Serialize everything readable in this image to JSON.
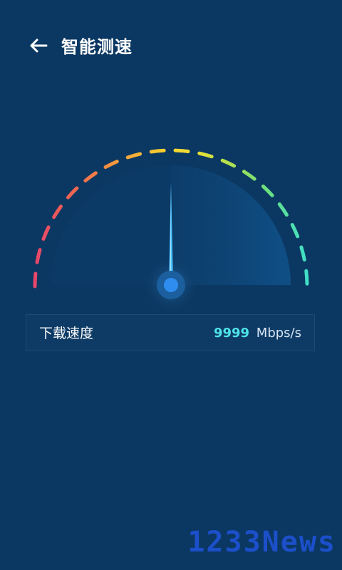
{
  "header": {
    "title": "智能测速",
    "back_icon": "arrow-left-icon"
  },
  "gauge": {
    "needle_level": 0.5,
    "colors": [
      "#e8466a",
      "#f0684f",
      "#f59a3c",
      "#f5c832",
      "#f0e034",
      "#b8e04a",
      "#6fe07a",
      "#3fe0c8"
    ]
  },
  "download": {
    "label": "下载速度",
    "value": "9999",
    "unit": "Mbps/s"
  },
  "watermark": {
    "text": "1233News"
  },
  "colors": {
    "background": "#0b3862",
    "accent": "#4fe3e6",
    "needle": "#4cc3ff"
  }
}
